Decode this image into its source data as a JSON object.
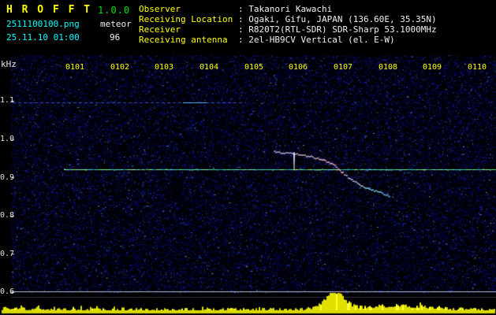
{
  "header": {
    "app_title": "H R O F F T",
    "version": "1.0.0",
    "filename": "2511100100.png",
    "mode_label": "meteor",
    "timestamp": "25.11.10 01:00",
    "count": "96",
    "info_rows": [
      {
        "label": "Observer",
        "value": ": Takanori Kawachi"
      },
      {
        "label": "Receiving Location",
        "value": ": Ogaki, Gifu, JAPAN (136.60E, 35.35N)"
      },
      {
        "label": "Receiver",
        "value": ": R820T2(RTL-SDR) SDR-Sharp 53.1000MHz"
      },
      {
        "label": "Receiving antenna",
        "value": ": 2el-HB9CV Vertical (el. E-W)"
      }
    ]
  },
  "chart_data": {
    "type": "heatmap",
    "title": "",
    "xlabel": "",
    "ylabel": "kHz",
    "x_ticks": [
      "0101",
      "0102",
      "0103",
      "0104",
      "0105",
      "0106",
      "0107",
      "0108",
      "0109",
      "0110"
    ],
    "y_ticks": [
      "1.1",
      "1.0",
      "0.9",
      "0.8",
      "0.7",
      "0.6"
    ],
    "ylim": [
      0.55,
      1.16
    ],
    "grid": false,
    "carrier_khz": 0.92,
    "carrier_start_minute": 0.75,
    "interference_khz": 1.095,
    "head_echo": {
      "minute": 5.88,
      "khz_top": 0.965,
      "khz_bottom": 0.918
    },
    "meteor_trace_time_khz": [
      [
        5.45,
        0.968
      ],
      [
        5.7,
        0.965
      ],
      [
        5.95,
        0.962
      ],
      [
        6.2,
        0.957
      ],
      [
        6.45,
        0.95
      ],
      [
        6.62,
        0.943
      ],
      [
        6.77,
        0.934
      ],
      [
        6.88,
        0.924
      ],
      [
        6.98,
        0.913
      ],
      [
        7.1,
        0.901
      ],
      [
        7.25,
        0.889
      ],
      [
        7.45,
        0.877
      ],
      [
        7.68,
        0.867
      ],
      [
        7.9,
        0.858
      ],
      [
        8.05,
        0.852
      ]
    ],
    "amplitude": {
      "burst_center_minute": 6.8,
      "secondary_center_minute": 8.2,
      "description": "yellow noise-level strip along bottom; strong burst near 0106.8 coinciding with meteor echo"
    }
  },
  "colors": {
    "background": "#000000",
    "title_yellow": "#ffff00",
    "version_green": "#00e000",
    "cyan_text": "#00ffff",
    "white_text": "#f0f0f0",
    "noise_blue": "#0000aa",
    "carrier_line": "#3fd8ae",
    "trace_pink": "#ffc3e1",
    "trace_cyan": "#91d4ff",
    "amplitude_yellow": "#e0e000"
  }
}
